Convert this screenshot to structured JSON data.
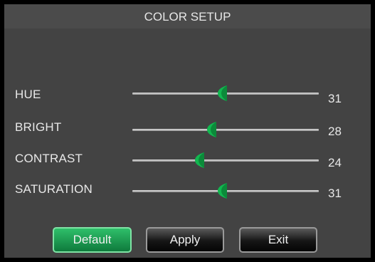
{
  "dialog": {
    "title": "COLOR SETUP"
  },
  "settings": [
    {
      "id": "hue",
      "label": "HUE",
      "value": "31",
      "level": 0.48
    },
    {
      "id": "bright",
      "label": "BRIGHT",
      "value": "28",
      "level": 0.425
    },
    {
      "id": "contrast",
      "label": "CONTRAST",
      "value": "24",
      "level": 0.36
    },
    {
      "id": "saturation",
      "label": "SATURATION",
      "value": "31",
      "level": 0.48
    }
  ],
  "buttons": {
    "default_label": "Default",
    "apply_label": "Apply",
    "exit_label": "Exit"
  },
  "colors": {
    "panel_background": "#434343",
    "thumb_green": "#12b850",
    "default_button": "#1f9d52"
  }
}
